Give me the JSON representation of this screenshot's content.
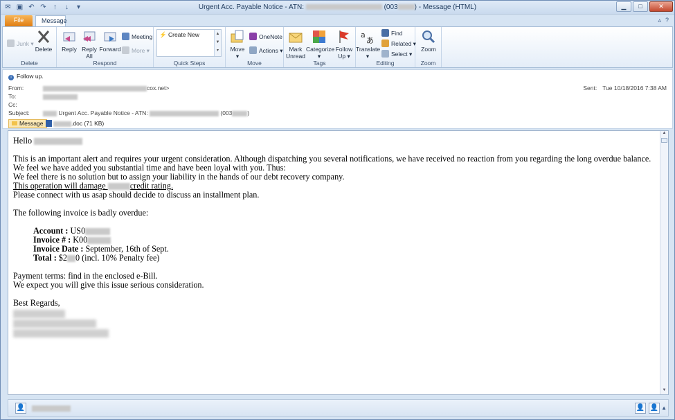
{
  "window": {
    "title_prefix": "",
    "title_main": "Urgent Acc. Payable Notice - ATN: ",
    "title_code": "(003",
    "title_suffix": ") - Message (HTML)"
  },
  "tabs": {
    "file": "File",
    "message": "Message"
  },
  "ribbon": {
    "delete_group": {
      "junk": "Junk",
      "delete": "Delete",
      "label": "Delete"
    },
    "respond_group": {
      "reply": "Reply",
      "reply_all_1": "Reply",
      "reply_all_2": "All",
      "forward": "Forward",
      "meeting": "Meeting",
      "more": "More",
      "label": "Respond"
    },
    "quicksteps_group": {
      "create_new": "Create New",
      "label": "Quick Steps"
    },
    "move_group": {
      "move": "Move",
      "onenote": "OneNote",
      "actions": "Actions",
      "label": "Move"
    },
    "tags_group": {
      "mark_unread_1": "Mark",
      "mark_unread_2": "Unread",
      "categorize": "Categorize",
      "follow_up_1": "Follow",
      "follow_up_2": "Up",
      "label": "Tags"
    },
    "editing_group": {
      "translate": "Translate",
      "find": "Find",
      "related": "Related",
      "select": "Select",
      "label": "Editing"
    },
    "zoom_group": {
      "zoom": "Zoom",
      "label": "Zoom"
    }
  },
  "header": {
    "follow_up": "Follow up.",
    "from_label": "From:",
    "from_value_suffix": "cox.net>",
    "to_label": "To:",
    "cc_label": "Cc:",
    "subject_label": "Subject:",
    "subject_value": "Urgent Acc. Payable Notice - ATN: ",
    "subject_code": "(003",
    "sent_label": "Sent:",
    "sent_value": "Tue 10/18/2016 7:38 AM"
  },
  "attachments": {
    "message_tab": "Message",
    "doc_suffix": ".doc (71 KB)"
  },
  "email": {
    "greeting": "Hello",
    "p1": "This is an important alert and requires your urgent consideration. Although dispatching you several notifications, we have received no reaction from you regarding the long overdue balance.",
    "p2": "We feel we have added you substantial time and have been loyal with you. Thus:",
    "p3": "We feel there is no solution but to assign your liability in the hands of our debt recovery company.",
    "p4_a": "This operation will damage ",
    "p4_b": "credit rating.",
    "p5": "Please connect with us asap should decide to discuss an installment plan.",
    "p6": "The following invoice is badly overdue:",
    "account_label": "Account :",
    "account_value": "US0",
    "invoice_label": "Invoice # :",
    "invoice_value": "K00",
    "date_label": "Invoice Date :",
    "date_value": "September, 16th of Sept.",
    "total_label": "Total :",
    "total_value_a": "$2",
    "total_value_b": "0 (incl. 10% Penalty fee)",
    "p7": "Payment terms: find in the enclosed e-Bill.",
    "p8": "We expect you will give this issue serious consideration.",
    "closing": "Best Regards,"
  }
}
